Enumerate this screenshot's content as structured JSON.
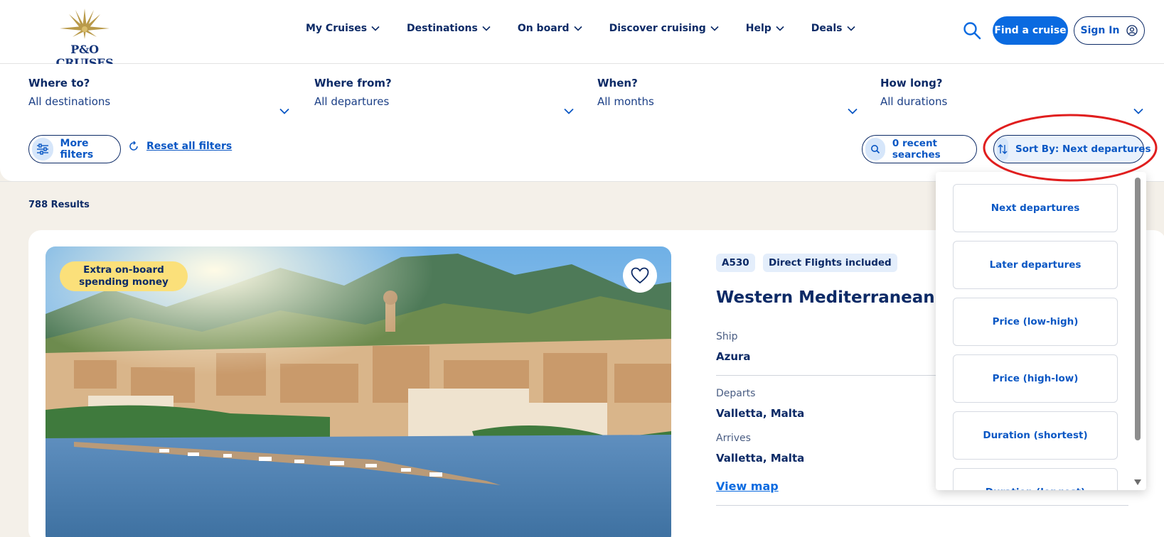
{
  "header": {
    "logo_text": "P&O CRUISES",
    "nav": [
      {
        "label": "My Cruises"
      },
      {
        "label": "Destinations"
      },
      {
        "label": "On board"
      },
      {
        "label": "Discover cruising"
      },
      {
        "label": "Help"
      },
      {
        "label": "Deals"
      }
    ],
    "find_label": "Find a cruise",
    "signin_label": "Sign In"
  },
  "filters": {
    "where_to": {
      "label": "Where to?",
      "value": "All destinations"
    },
    "where_from": {
      "label": "Where from?",
      "value": "All departures"
    },
    "when": {
      "label": "When?",
      "value": "All months"
    },
    "how_long": {
      "label": "How long?",
      "value": "All durations"
    },
    "more_filters": "More filters",
    "reset": "Reset all filters",
    "recent_searches": "0 recent searches",
    "sort_label": "Sort By: Next departures"
  },
  "results": {
    "count": "788 Results",
    "card": {
      "promo": "Extra on-board spending money",
      "code": "A530",
      "flights_tag": "Direct Flights included",
      "title": "Western Mediterranean Fly",
      "ship_label": "Ship",
      "ship": "Azura",
      "departs_label": "Departs",
      "departs": "Valletta, Malta",
      "arrives_label": "Arrives",
      "arrives": "Valletta, Malta",
      "view_map": "View map"
    }
  },
  "sort_menu": {
    "options": [
      {
        "label": "Next departures"
      },
      {
        "label": "Later departures"
      },
      {
        "label": "Price (low-high)"
      },
      {
        "label": "Price (high-low)"
      },
      {
        "label": "Duration (shortest)"
      },
      {
        "label": "Duration (longest)"
      }
    ]
  },
  "colors": {
    "brand_blue": "#0a6ae0",
    "navy": "#0c2a66",
    "page_bg": "#f4f0e9",
    "promo_yellow": "#fbe07a",
    "highlight_red": "#e01e1e"
  }
}
